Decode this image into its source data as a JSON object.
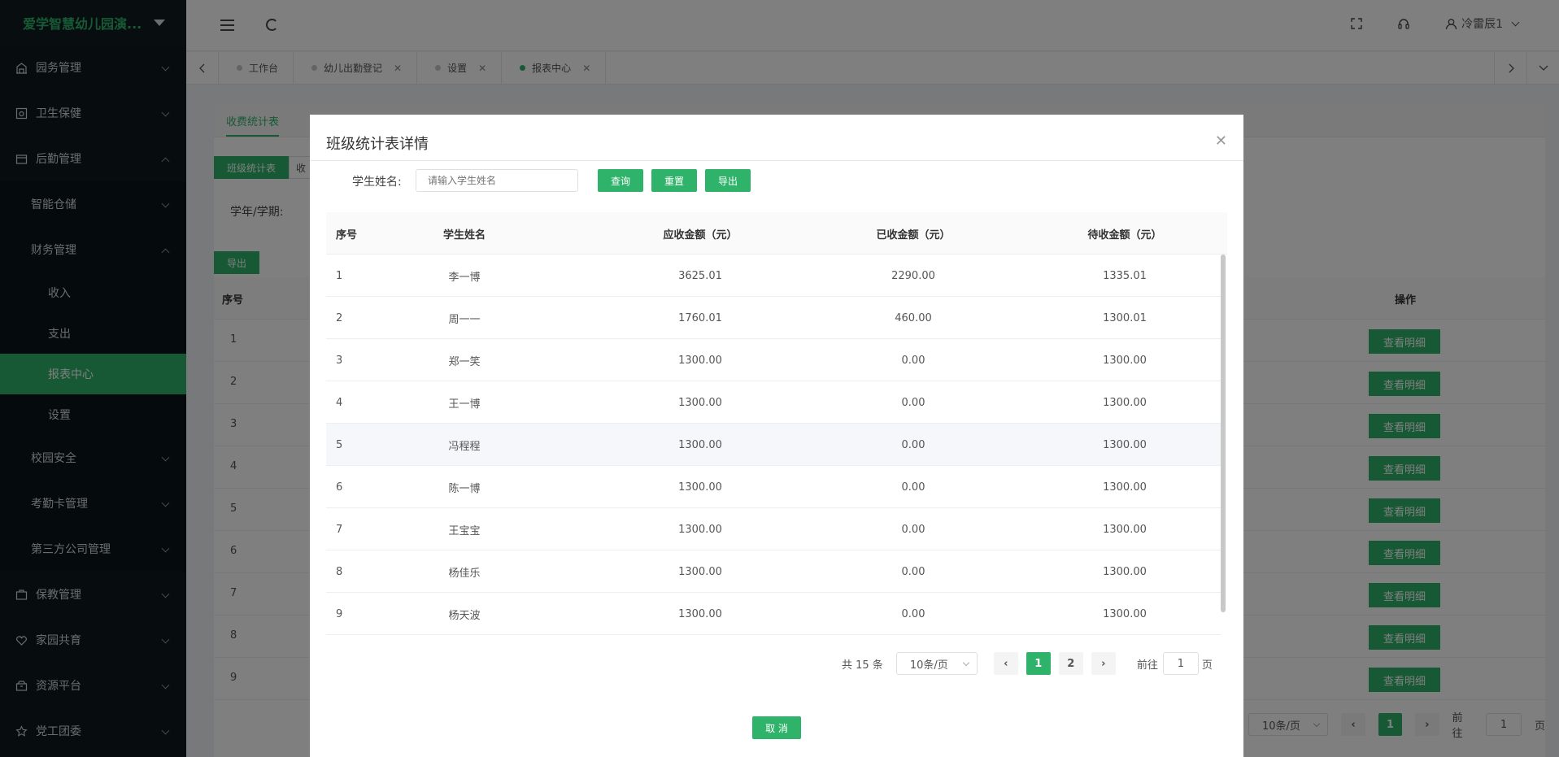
{
  "app": {
    "logo_text": "爱学智慧幼儿园演..."
  },
  "sidebar": {
    "menu": [
      {
        "label": "园务管理",
        "icon": "building-icon"
      },
      {
        "label": "卫生保健",
        "icon": "health-icon"
      },
      {
        "label": "后勤管理",
        "icon": "logistics-icon"
      }
    ],
    "logistics_sub": [
      {
        "label": "智能仓储"
      },
      {
        "label": "财务管理"
      }
    ],
    "finance_leaves": [
      {
        "label": "收入"
      },
      {
        "label": "支出"
      },
      {
        "label": "报表中心"
      },
      {
        "label": "设置"
      }
    ],
    "logistics_sub2": [
      {
        "label": "校园安全"
      },
      {
        "label": "考勤卡管理"
      },
      {
        "label": "第三方公司管理"
      }
    ],
    "menu2": [
      {
        "label": "保教管理",
        "icon": "briefcase-icon"
      },
      {
        "label": "家园共育",
        "icon": "heart-icon"
      },
      {
        "label": "资源平台",
        "icon": "archive-icon"
      },
      {
        "label": "党工团委",
        "icon": "star-icon"
      }
    ]
  },
  "header": {
    "user_name": "冷雷辰1"
  },
  "tabs": [
    {
      "label": "工作台",
      "closable": false
    },
    {
      "label": "幼儿出勤登记",
      "closable": true
    },
    {
      "label": "设置",
      "closable": true
    },
    {
      "label": "报表中心",
      "closable": true,
      "active": true
    }
  ],
  "background": {
    "subtab": "收费统计表",
    "inner_tab_active": "班级统计表",
    "inner_tab_other": "收",
    "term_label": "学年/学期:",
    "export_label": "导出",
    "col_seq": "序号",
    "col_action": "操作",
    "detail_label": "查看明细",
    "rows": [
      "1",
      "2",
      "3",
      "4",
      "5",
      "6",
      "7",
      "8",
      "9"
    ],
    "page_size": "10条/页",
    "page_current": "1",
    "goto_prefix": "前往",
    "goto_value": "1",
    "goto_suffix": "页"
  },
  "modal": {
    "title": "班级统计表详情",
    "search_label": "学生姓名:",
    "search_placeholder": "请输入学生姓名",
    "query_label": "查询",
    "reset_label": "重置",
    "export_label": "导出",
    "columns": [
      "序号",
      "学生姓名",
      "应收金额（元）",
      "已收金额（元）",
      "待收金额（元）"
    ],
    "rows": [
      [
        "1",
        "李一博",
        "3625.01",
        "2290.00",
        "1335.01"
      ],
      [
        "2",
        "周一一",
        "1760.01",
        "460.00",
        "1300.01"
      ],
      [
        "3",
        "郑一笑",
        "1300.00",
        "0.00",
        "1300.00"
      ],
      [
        "4",
        "王一博",
        "1300.00",
        "0.00",
        "1300.00"
      ],
      [
        "5",
        "冯程程",
        "1300.00",
        "0.00",
        "1300.00"
      ],
      [
        "6",
        "陈一博",
        "1300.00",
        "0.00",
        "1300.00"
      ],
      [
        "7",
        "王宝宝",
        "1300.00",
        "0.00",
        "1300.00"
      ],
      [
        "8",
        "杨佳乐",
        "1300.00",
        "0.00",
        "1300.00"
      ],
      [
        "9",
        "杨天波",
        "1300.00",
        "0.00",
        "1300.00"
      ]
    ],
    "pagination": {
      "total_text": "共 15 条",
      "page_size": "10条/页",
      "pages": [
        "1",
        "2"
      ],
      "current": "1",
      "goto_prefix": "前往",
      "goto_value": "1",
      "goto_suffix": "页"
    },
    "cancel_label": "取 消"
  },
  "colors": {
    "accent": "#2fb36b",
    "sidebar_bg": "#0e1a1f"
  }
}
